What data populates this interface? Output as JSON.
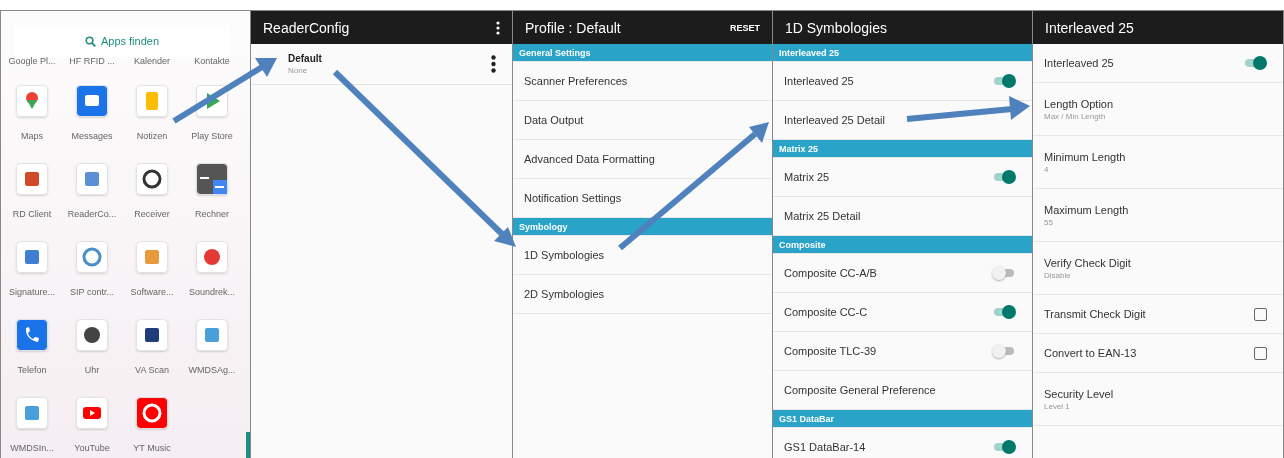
{
  "launcher": {
    "search_label": "Apps finden",
    "top_labels": [
      "Google Pl...",
      "HF RFID ...",
      "Kalender",
      "Kontakte"
    ],
    "apps": [
      {
        "label": "Maps"
      },
      {
        "label": "Messages"
      },
      {
        "label": "Notizen"
      },
      {
        "label": "Play Store"
      },
      {
        "label": "RD Client"
      },
      {
        "label": "ReaderCo..."
      },
      {
        "label": "Receiver"
      },
      {
        "label": "Rechner"
      },
      {
        "label": "Signature..."
      },
      {
        "label": "SIP contr..."
      },
      {
        "label": "Software..."
      },
      {
        "label": "Soundrek..."
      },
      {
        "label": "Telefon"
      },
      {
        "label": "Uhr"
      },
      {
        "label": "VA Scan"
      },
      {
        "label": "WMDSAg..."
      },
      {
        "label": "WMDSIn..."
      },
      {
        "label": "YouTube"
      },
      {
        "label": "YT Music"
      }
    ]
  },
  "reader_config": {
    "title": "ReaderConfig",
    "profiles": [
      {
        "name": "Default",
        "subtitle": "None"
      }
    ]
  },
  "profile": {
    "title": "Profile : Default",
    "reset": "RESET",
    "sections": [
      {
        "header": "General Settings",
        "items": [
          {
            "label": "Scanner Preferences"
          },
          {
            "label": "Data Output"
          },
          {
            "label": "Advanced Data Formatting"
          },
          {
            "label": "Notification Settings"
          }
        ]
      },
      {
        "header": "Symbology",
        "items": [
          {
            "label": "1D Symbologies"
          },
          {
            "label": "2D Symbologies"
          }
        ]
      }
    ]
  },
  "symbologies": {
    "title": "1D Symbologies",
    "sections": [
      {
        "header": "Interleaved 25",
        "items": [
          {
            "label": "Interleaved 25",
            "kind": "toggle",
            "on": true
          },
          {
            "label": "Interleaved 25 Detail",
            "kind": "link"
          }
        ]
      },
      {
        "header": "Matrix 25",
        "items": [
          {
            "label": "Matrix 25",
            "kind": "toggle",
            "on": true
          },
          {
            "label": "Matrix 25 Detail",
            "kind": "link"
          }
        ]
      },
      {
        "header": "Composite",
        "items": [
          {
            "label": "Composite CC-A/B",
            "kind": "toggle",
            "on": false
          },
          {
            "label": "Composite CC-C",
            "kind": "toggle",
            "on": true
          },
          {
            "label": "Composite TLC-39",
            "kind": "toggle",
            "on": false
          },
          {
            "label": "Composite General Preference",
            "kind": "link"
          }
        ]
      },
      {
        "header": "GS1 DataBar",
        "items": [
          {
            "label": "GS1 DataBar-14",
            "kind": "toggle",
            "on": true
          }
        ]
      }
    ]
  },
  "detail": {
    "title": "Interleaved 25",
    "items": [
      {
        "label": "Interleaved 25",
        "kind": "toggle",
        "on": true
      },
      {
        "label": "Length Option",
        "kind": "value",
        "value": "Max / Min Length"
      },
      {
        "label": "Minimum Length",
        "kind": "value",
        "value": "4"
      },
      {
        "label": "Maximum Length",
        "kind": "value",
        "value": "55"
      },
      {
        "label": "Verify Check Digit",
        "kind": "value",
        "value": "Disable"
      },
      {
        "label": "Transmit Check Digit",
        "kind": "checkbox",
        "checked": false
      },
      {
        "label": "Convert to EAN-13",
        "kind": "checkbox",
        "checked": false
      },
      {
        "label": "Security Level",
        "kind": "value",
        "value": "Level 1"
      }
    ]
  }
}
